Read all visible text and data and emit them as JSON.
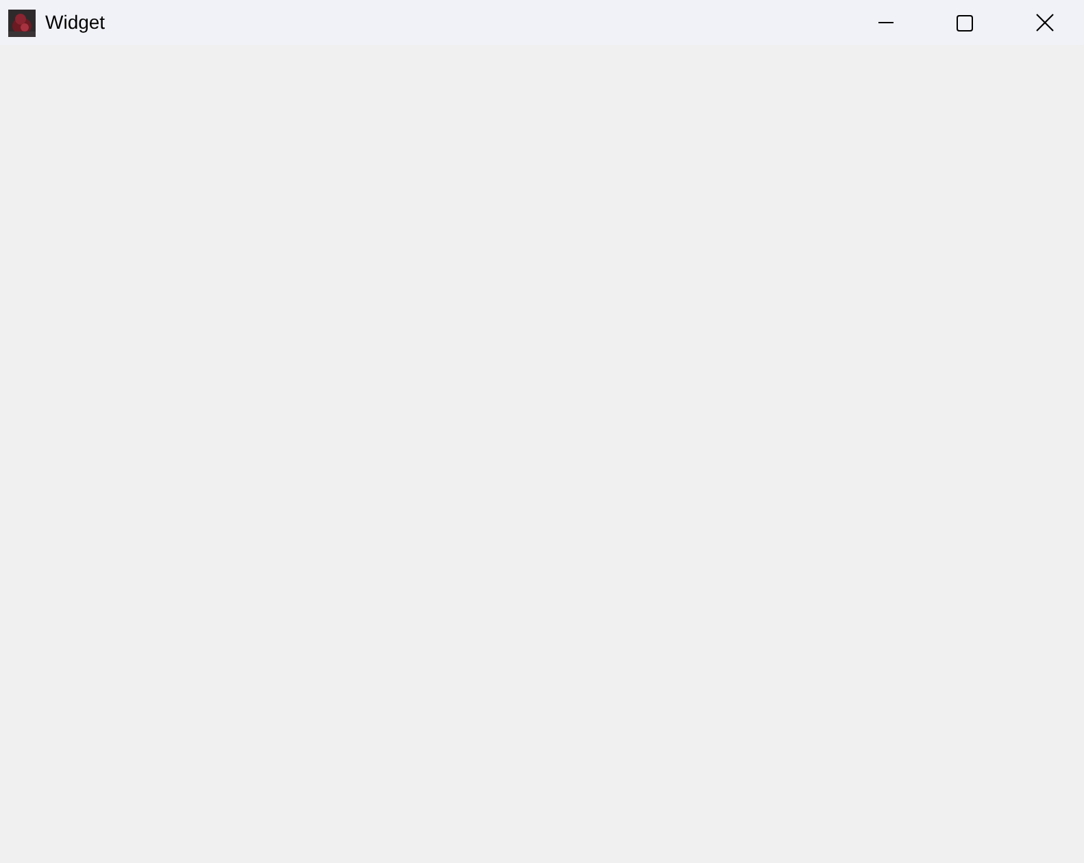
{
  "window": {
    "title": "Widget"
  }
}
